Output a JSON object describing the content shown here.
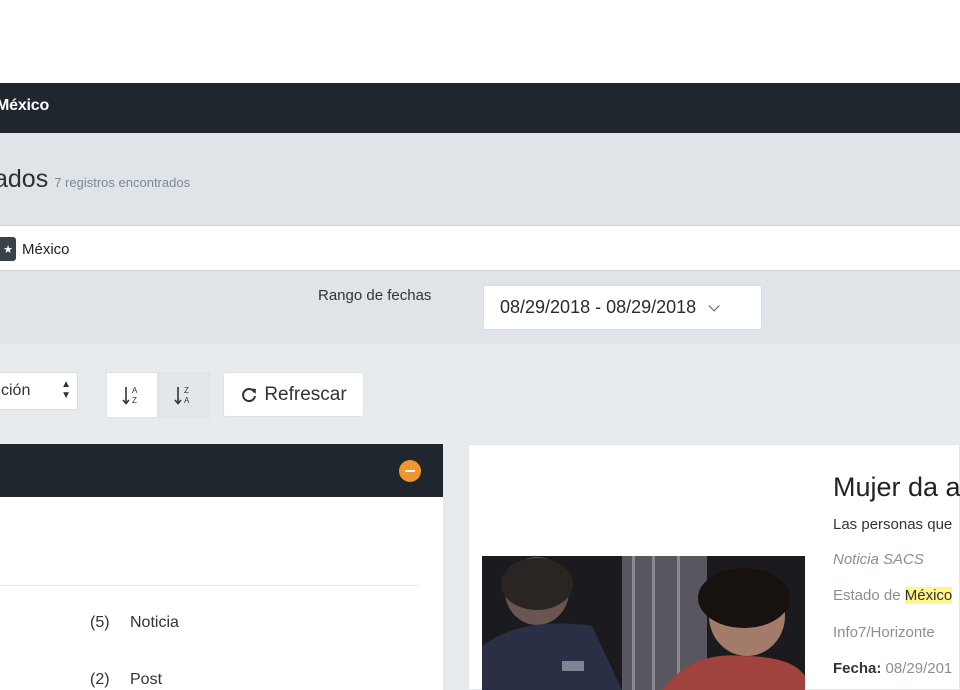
{
  "header": {
    "title": "México"
  },
  "results": {
    "heading": "ados",
    "count_text": "7 registros encontrados"
  },
  "filters": {
    "active_tag": "México"
  },
  "date_range": {
    "label": "Rango de fechas",
    "value": "08/29/2018 - 08/29/2018"
  },
  "toolbar": {
    "sort_select_value": "ción",
    "sort_asc_icon": "sort-alpha-asc-icon",
    "sort_desc_icon": "sort-alpha-desc-icon",
    "refresh_label": "Refrescar"
  },
  "categories": [
    {
      "count": "(5)",
      "name": "Noticia"
    },
    {
      "count": "(2)",
      "name": "Post"
    }
  ],
  "article": {
    "title": "Mujer da a",
    "subtitle": "Las personas que",
    "type": "Noticia SACS",
    "state_prefix": "Estado de",
    "state_highlight": "México",
    "source": "Info7/Horizonte",
    "date_label": "Fecha:",
    "date_value": "08/29/201"
  },
  "colors": {
    "topbar": "#1f262d",
    "band": "#dfe4e9",
    "accent_orange": "#f0962e",
    "highlight": "#fff68a"
  }
}
